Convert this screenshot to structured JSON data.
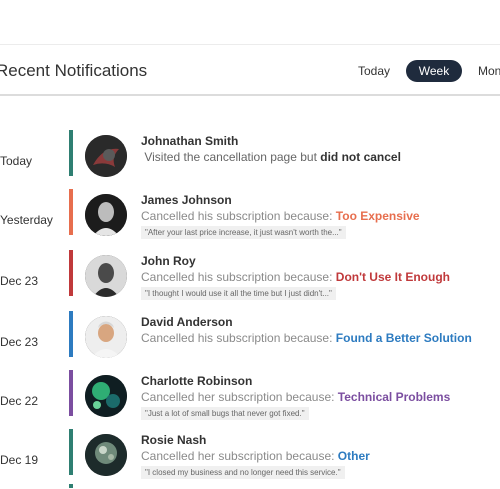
{
  "header": {
    "title": "Recent Notifications",
    "tabs": [
      {
        "label": "Today",
        "active": false
      },
      {
        "label": "Week",
        "active": true
      },
      {
        "label": "Mon",
        "active": false
      }
    ]
  },
  "colors": {
    "active_tab_bg": "#1f2b3d",
    "teal": "#2f7f72",
    "orange": "#e76e4e",
    "red": "#c0393b",
    "blue": "#2d7bc0",
    "purple": "#7b4ea0"
  },
  "notifications": [
    {
      "date": "Today",
      "name": "Johnathan Smith",
      "prefix": "Visited the cancellation page but",
      "reason": "did not cancel",
      "quote": "",
      "accent": "#2f7f72",
      "reason_color": "#333333"
    },
    {
      "date": "Yesterday",
      "name": "James Johnson",
      "prefix": "Cancelled his subscription because:",
      "reason": "Too Expensive",
      "quote": "\"After your last price increase, it just wasn't worth the...\"",
      "accent": "#e76e4e",
      "reason_color": "#e76e4e"
    },
    {
      "date": "Dec 23",
      "name": "John Roy",
      "prefix": "Cancelled his subscription because:",
      "reason": "Don't Use It Enough",
      "quote": "\"I thought I would use it all the time but I just didn't...\"",
      "accent": "#c0393b",
      "reason_color": "#c0393b"
    },
    {
      "date": "Dec 23",
      "name": "David Anderson",
      "prefix": "Cancelled his subscription because:",
      "reason": "Found a Better Solution",
      "quote": "",
      "accent": "#2d7bc0",
      "reason_color": "#2d7bc0"
    },
    {
      "date": "Dec 22",
      "name": "Charlotte Robinson",
      "prefix": "Cancelled her subscription because:",
      "reason": "Technical Problems",
      "quote": "\"Just a lot of small bugs that never got fixed.\"",
      "accent": "#7b4ea0",
      "reason_color": "#7b4ea0"
    },
    {
      "date": "Dec 19",
      "name": "Rosie Nash",
      "prefix": "Cancelled her subscription because:",
      "reason": "Other",
      "quote": "\"I closed my business and no longer need this service.\"",
      "accent": "#2f7f72",
      "reason_color": "#2d7bc0"
    }
  ]
}
